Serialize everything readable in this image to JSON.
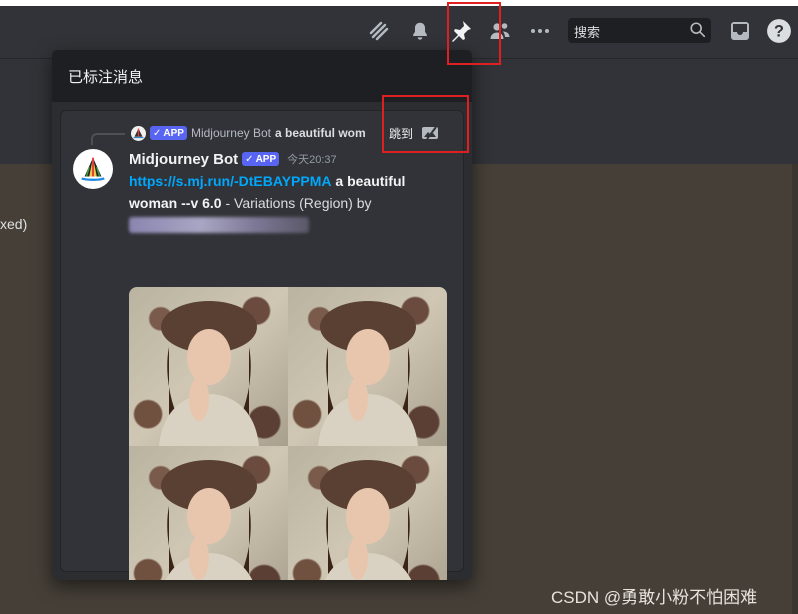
{
  "topbar": {
    "search_placeholder": "搜索",
    "icons": [
      "threads-icon",
      "bell-icon",
      "pin-icon",
      "members-icon",
      "more-icon",
      "search-icon",
      "inbox-icon",
      "help-icon"
    ]
  },
  "side_text": "xed)",
  "pins_panel": {
    "title": "已标注消息",
    "message": {
      "reply": {
        "badge": "APP",
        "author": "Midjourney Bot",
        "snippet": "a beautiful wom"
      },
      "jump_label": "跳到",
      "author": "Midjourney Bot",
      "badge": "APP",
      "timestamp": "今天20:37",
      "link_text": "https://s.mj.run/-DtEBAYPPMA",
      "prompt_bold": "a beautiful woman --v 6.0",
      "suffix": " - Variations (Region) by",
      "image_description": "2x2 grid of AI generated portraits"
    }
  },
  "watermark": "CSDN @勇敢小粉不怕困难",
  "colors": {
    "accent_highlight": "#e02020",
    "badge": "#5865f2",
    "link": "#00a8fc",
    "panel_bg": "#2b2d31",
    "card_bg": "#313338"
  }
}
